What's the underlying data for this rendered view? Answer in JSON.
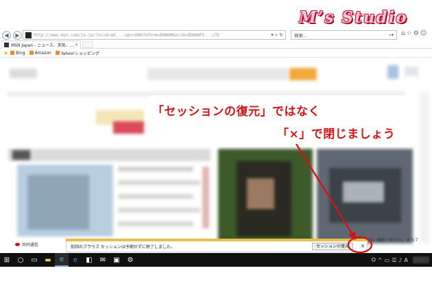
{
  "logo": {
    "text": "M’s Studio"
  },
  "browser": {
    "url": "http://www.msn.com/ja-jp/?ocid=ad_...&pc=U06?&form=DHWGM&ocid=dDAAHPI...c7b",
    "search_placeholder": "検索...",
    "tab_title": "MSN Japan - ニュース、天気、...",
    "tab_close": "×",
    "favorites": [
      "Bing",
      "Amazon",
      "Yahoo!ショッピング"
    ]
  },
  "notification": {
    "message": "前回のブラウズ セッションは予期せずに終了しました。",
    "restore_label": "セッションの復元",
    "close_label": "×"
  },
  "page": {
    "kyodo_label": "共同通信",
    "side_peek": "白い撮影で来たら」オ 5:7"
  },
  "annotation": {
    "line1": "「セッションの復元」ではなく",
    "line2": "「×」で閉じましょう",
    "color": "#d21414"
  },
  "taskbar": {
    "icons": [
      "windows-start-icon",
      "cortana-icon",
      "task-view-icon",
      "file-explorer-icon",
      "ie-icon",
      "edge-icon",
      "store-icon",
      "mail-icon",
      "photos-icon",
      "settings-icon"
    ]
  }
}
